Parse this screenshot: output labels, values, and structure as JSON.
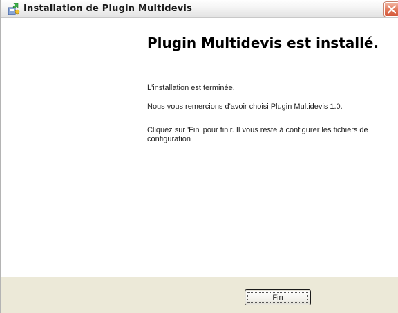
{
  "window": {
    "title": "Installation de Plugin Multidevis",
    "icon": "installer-icon",
    "close_icon": "close-icon"
  },
  "content": {
    "heading": "Plugin Multidevis est installé.",
    "paragraphs": [
      "L'installation est terminée.",
      "Nous vous remercions d'avoir choisi Plugin Multidevis 1.0.",
      "Cliquez sur 'Fin' pour finir. Il vous reste à configurer les fichiers de configuration"
    ]
  },
  "buttons": {
    "finish_label": "Fin"
  },
  "colors": {
    "close_button": "#d4573a",
    "dialog_background": "#ece9d8",
    "content_background": "#ffffff"
  }
}
